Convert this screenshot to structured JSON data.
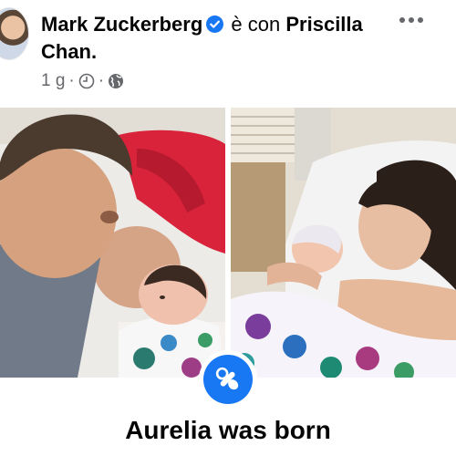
{
  "post": {
    "author": "Mark Zuckerberg",
    "with_text": "è con",
    "tagged": "Priscilla Chan.",
    "time": "1 g",
    "dot1": "·",
    "dot2": "·",
    "more": "•••"
  },
  "event": {
    "title": "Aurelia was born",
    "icon": "pacifier-icon"
  },
  "colors": {
    "brand_blue": "#1877f2",
    "meta_gray": "#65676b"
  }
}
